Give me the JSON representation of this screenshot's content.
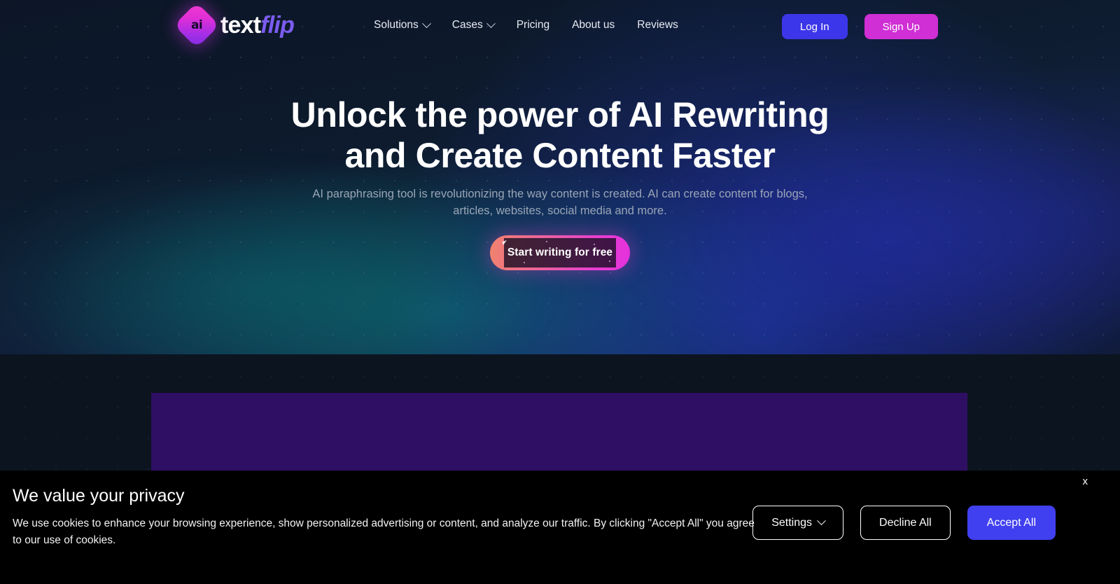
{
  "header": {
    "logo": {
      "mark_text": "ai",
      "word_primary": "text",
      "word_secondary": "flip",
      "mark_gradient_from": "#f23ad0",
      "mark_gradient_to": "#7c2ae0"
    },
    "nav": [
      {
        "label": "Solutions",
        "has_dropdown": true,
        "icon": "chevron-down-icon"
      },
      {
        "label": "Cases",
        "has_dropdown": true,
        "icon": "chevron-down-icon"
      },
      {
        "label": "Pricing",
        "has_dropdown": false,
        "icon": ""
      },
      {
        "label": "About us",
        "has_dropdown": false,
        "icon": ""
      },
      {
        "label": "Reviews",
        "has_dropdown": false,
        "icon": ""
      }
    ],
    "login_label": "Log In",
    "signup_label": "Sign Up",
    "login_color": "#3c36ea",
    "signup_color": "#cf2fd4"
  },
  "hero": {
    "headline": "Unlock the power of AI Rewriting and Create Content Faster",
    "subheadline": "AI paraphrasing tool is revolutionizing the way content is created. AI can create content for blogs, articles, websites, social media and more.",
    "cta_label": "Start writing for free",
    "cta_gradient_from": "#f0836d",
    "cta_gradient_to": "#e431dd",
    "cursor_icon": "mouse-pointer-icon"
  },
  "cookie_banner": {
    "title": "We value your privacy",
    "body": "We use cookies to enhance your browsing experience, show personalized advertising or content, and analyze our traffic. By clicking \"Accept All\" you agree to our use of cookies.",
    "settings_label": "Settings",
    "settings_icon": "chevron-down-icon",
    "decline_label": "Decline All",
    "accept_label": "Accept All",
    "accept_color": "#4040f0",
    "close_label": "x"
  },
  "section_below": {
    "panel_color": "#2e0f63",
    "background_color": "#0c1420"
  }
}
